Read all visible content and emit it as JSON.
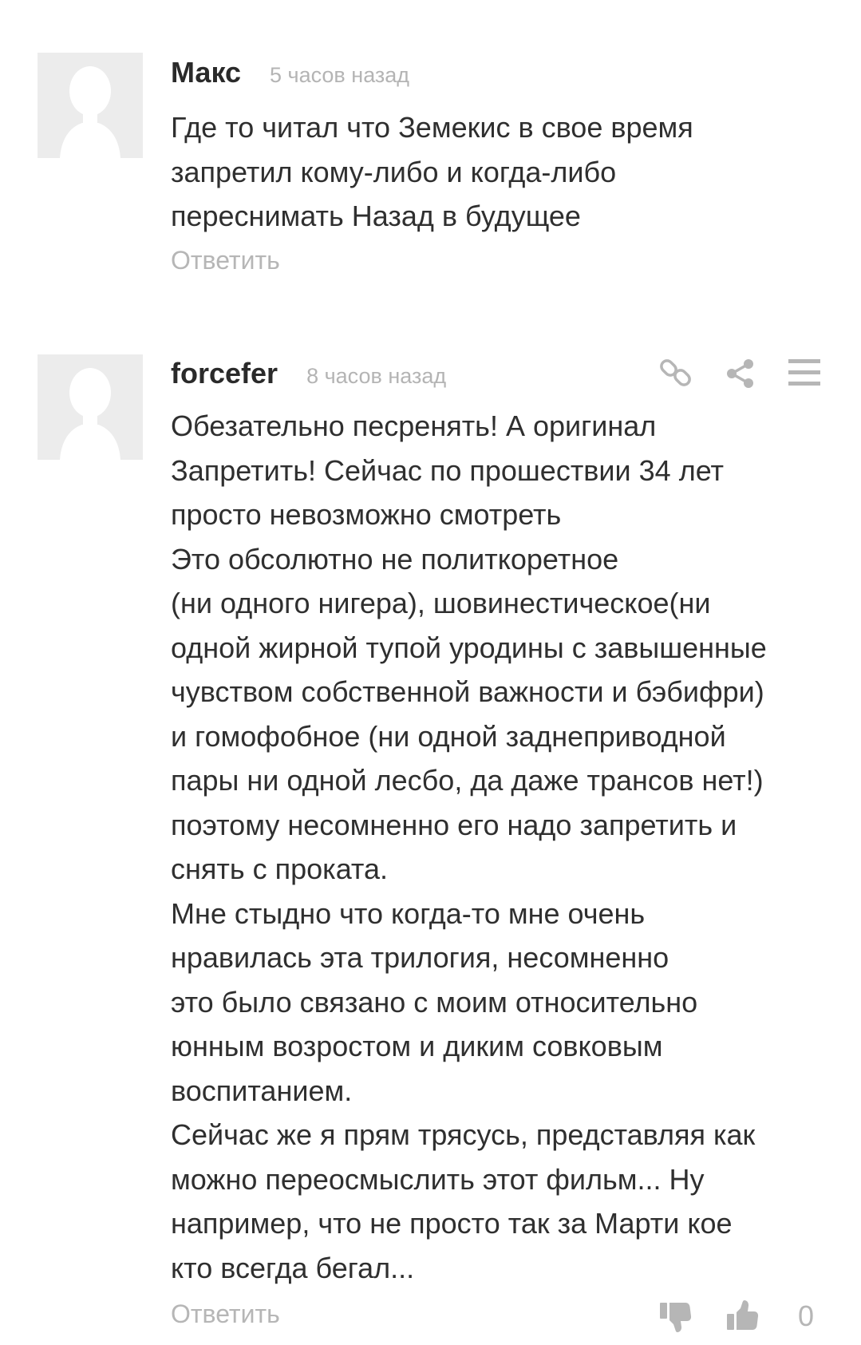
{
  "comments": [
    {
      "author": "Макс",
      "time": "5 часов назад",
      "lines": [
        "Где то читал что Земекис в свое время",
        "запретил кому-либо и когда-либо",
        "переснимать Назад в будущее"
      ],
      "reply_label": "Ответить"
    },
    {
      "author": "forcefer",
      "time": "8 часов назад",
      "lines": [
        "Обезательно песренять! А оригинал",
        "Запретить! Сейчас по прошествии 34 лет",
        "просто невозможно смотреть",
        "Это обсолютно не политкоретное",
        "(ни одного нигера), шовинестическое(ни",
        "одной жирной тупой уродины с завышенные",
        "чувством собственной важности и бэбифри)",
        "и гомофобное (ни одной заднеприводной",
        "пары ни одной лесбо, да даже трансов нет!)",
        "поэтому несомненно его надо запретить и",
        "снять с проката.",
        "Мне стыдно что когда-то мне очень",
        "нравилась эта трилогия, несомненно",
        "это было связано с моим относительно",
        "юнным возростом и диким совковым",
        "воспитанием.",
        "Сейчас же я прям трясусь, представляя как",
        "можно переосмыслить этот фильм... Ну",
        "например, что не просто так за Марти кое",
        "кто всегда бегал..."
      ],
      "reply_label": "Ответить",
      "vote_count": "0"
    }
  ],
  "icons": {
    "avatar": "default-avatar-silhouette",
    "link": "link-icon",
    "share": "share-icon",
    "menu": "menu-icon",
    "dislike": "thumbs-down-icon",
    "like": "thumbs-up-icon"
  },
  "colors": {
    "text": "#2f2f2f",
    "muted": "#b6b6b6",
    "avatar_bg": "#ececec",
    "avatar_fg": "#ffffff"
  }
}
